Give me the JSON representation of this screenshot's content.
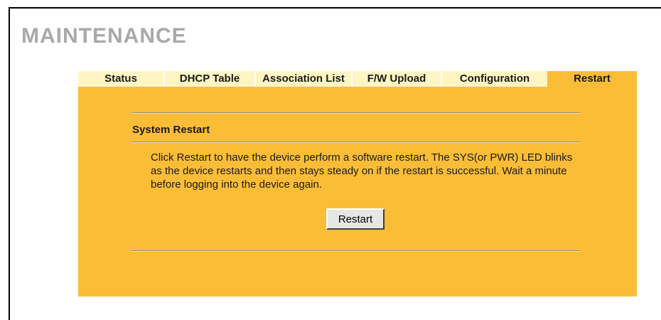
{
  "page_title": "MAINTENANCE",
  "tabs": [
    {
      "label": "Status",
      "active": false
    },
    {
      "label": "DHCP Table",
      "active": false
    },
    {
      "label": "Association List",
      "active": false
    },
    {
      "label": "F/W Upload",
      "active": false
    },
    {
      "label": "Configuration",
      "active": false
    },
    {
      "label": "Restart",
      "active": true
    }
  ],
  "section": {
    "title": "System Restart",
    "description": "Click Restart to have the device perform a software restart. The SYS(or PWR) LED blinks as the device restarts and then stays steady on if the restart is successful. Wait a minute before logging into the device again."
  },
  "restart_button_label": "Restart",
  "colors": {
    "tab_bg": "#fff5c4",
    "panel_bg": "#fbbd36",
    "title_color": "#a9a9a9"
  }
}
